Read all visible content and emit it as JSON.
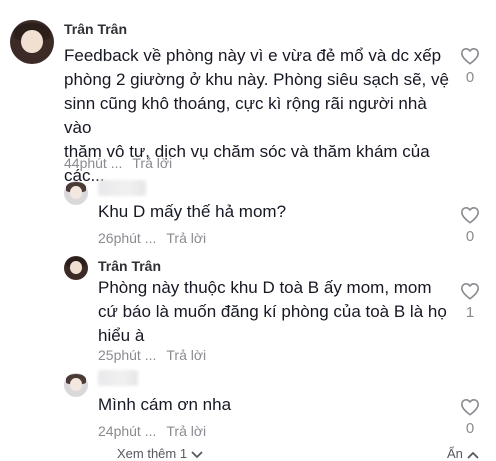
{
  "comments": [
    {
      "username": "Trân Trân",
      "text_lines": [
        "Feedback về phòng này vì e vừa đẻ mổ và dc xếp",
        "phòng 2 giường ở khu này. Phòng siêu sạch sẽ, vệ",
        "sinn cũng khô thoáng, cực kì rộng rãi người nhà vào",
        "thăm vô tư, dịch vụ chăm sóc và thăm khám của",
        "các..."
      ],
      "time": "44phút ...",
      "reply_label": "Trả lời",
      "likes": "0"
    },
    {
      "username": "",
      "text_lines": [
        "Khu D mấy thế hả mom?"
      ],
      "time": "26phút ...",
      "reply_label": "Trả lời",
      "likes": "0"
    },
    {
      "username": "Trân Trân",
      "text_lines": [
        "Phòng này thuộc khu D toà B ấy mom, mom",
        "cứ báo là muốn đăng kí phòng của toà B là họ",
        "hiểu à"
      ],
      "time": "25phút ...",
      "reply_label": "Trả lời",
      "likes": "1"
    },
    {
      "username": "",
      "text_lines": [
        "Mình cám ơn nha"
      ],
      "time": "24phút ...",
      "reply_label": "Trả lời",
      "likes": "0"
    }
  ],
  "footer": {
    "see_more_label": "Xem thêm 1",
    "hide_label": "Ẩn"
  },
  "icons": {
    "like": "heart-outline-icon",
    "expand": "chevron-down-icon",
    "collapse": "chevron-up-icon"
  },
  "colors": {
    "text": "#161823",
    "secondary": "#8a8b91"
  }
}
